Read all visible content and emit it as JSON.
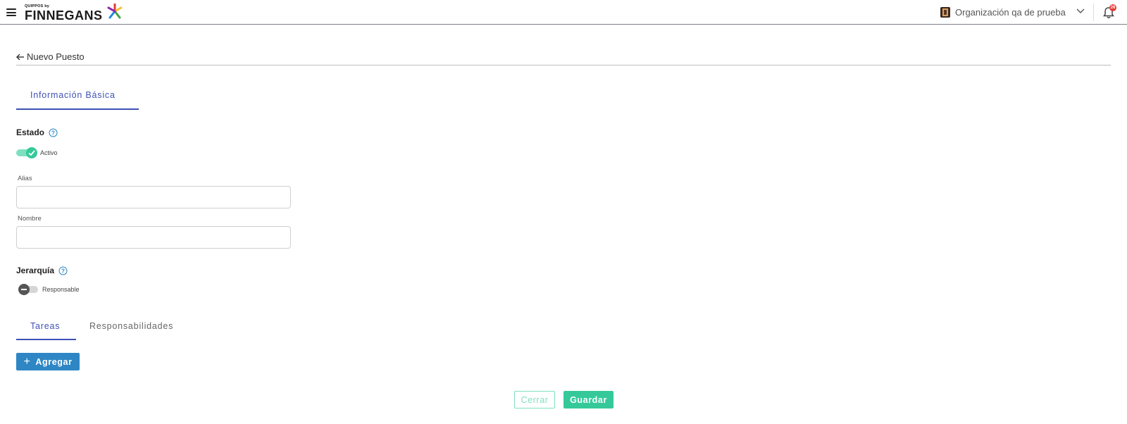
{
  "header": {
    "logo_small": "QUIPPOS by",
    "logo_big": "FINNEGANS",
    "organization": "Organización qa de prueba",
    "notifications_count": "26",
    "icons": [
      "menu-icon",
      "organization-icon",
      "chevron-down-icon",
      "bell-icon"
    ]
  },
  "page": {
    "back_title": "Nuevo Puesto"
  },
  "tabs": {
    "main": [
      "Información Básica"
    ],
    "sub": [
      "Tareas",
      "Responsabilidades"
    ]
  },
  "estado": {
    "label": "Estado",
    "switch_label": "Activo",
    "active": true
  },
  "fields": {
    "alias_label": "Alias",
    "alias_value": "",
    "nombre_label": "Nombre",
    "nombre_value": ""
  },
  "jerarquia": {
    "label": "Jerarquía",
    "switch_label": "Responsable",
    "active": false
  },
  "actions": {
    "add_label": "Agregar",
    "close_label": "Cerrar",
    "save_label": "Guardar"
  },
  "colors": {
    "accent_blue": "#3f51b5",
    "button_blue": "#2f86c4",
    "success_green": "#35c99a",
    "light_green": "#7fe0c0",
    "badge_red": "#e53935"
  }
}
